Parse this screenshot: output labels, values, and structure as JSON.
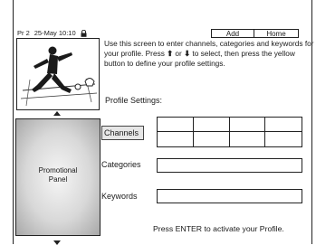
{
  "header": {
    "program": "Pr 2",
    "datetime": "25-May 10:10",
    "lock_icon": "lock-icon"
  },
  "tabs": [
    {
      "label": "Add"
    },
    {
      "label": "Home"
    }
  ],
  "instructions": {
    "text_1": "Use this screen to enter channels, categories and keywords for your profile. Press ",
    "up_arrow": "⬆",
    "text_2": " or ",
    "down_arrow": "⬇",
    "text_3": " to select, then press the yellow button to define your profile settings."
  },
  "thumbnail": {
    "icon": "soccer-player-icon"
  },
  "profile_settings": {
    "title": "Profile Settings:",
    "channels_label": "Channels",
    "categories_label": "Categories",
    "keywords_label": "Keywords"
  },
  "promo_panel": {
    "line1": "Promotional",
    "line2": "Panel"
  },
  "footer": {
    "message": "Press ENTER to activate your Profile."
  },
  "colors": {
    "border": "#222222",
    "highlight": "#e6e6e6"
  }
}
